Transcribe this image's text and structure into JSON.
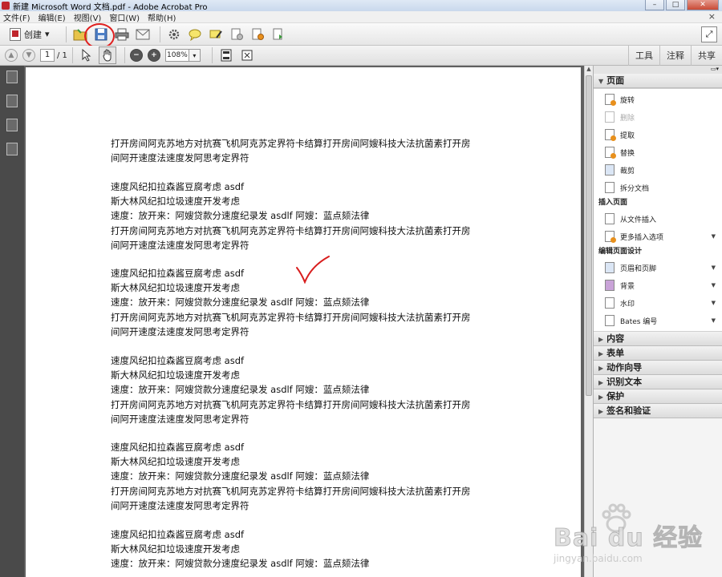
{
  "window": {
    "title": "新建 Microsoft Word 文档.pdf - Adobe Acrobat Pro",
    "min": "–",
    "max": "□",
    "close": "✕"
  },
  "menu": [
    "文件(F)",
    "编辑(E)",
    "视图(V)",
    "窗口(W)",
    "帮助(H)"
  ],
  "menu_close": "×",
  "toolbar": {
    "create_label": "创建",
    "create_arrow": "▾"
  },
  "nav": {
    "current_page": "1",
    "total_pages": "/ 1",
    "zoom": "108%",
    "zoom_arrow": "▾"
  },
  "right_tabs": [
    "工具",
    "注释",
    "共享"
  ],
  "document": {
    "paragraphs": [
      [
        "打开房间阿克苏地方对抗赛飞机阿克苏定界符卡结算打开房间阿嫂科技大法抗菌素打开房",
        "间阿开速度法速度发阿思考定界符"
      ],
      [
        "速度风纪扣拉森酱豆腐考虑 asdf",
        "斯大林风纪扣垃圾速度开发考虑",
        "速度：放开来：阿嫂贷款分速度纪录发 asdlf 阿嫂：蓝点颏法律",
        "打开房间阿克苏地方对抗赛飞机阿克苏定界符卡结算打开房间阿嫂科技大法抗菌素打开房",
        "间阿开速度法速度发阿思考定界符"
      ],
      [
        "速度风纪扣拉森酱豆腐考虑 asdf",
        "斯大林风纪扣垃圾速度开发考虑",
        "速度：放开来：阿嫂贷款分速度纪录发 asdlf 阿嫂：蓝点颏法律",
        "打开房间阿克苏地方对抗赛飞机阿克苏定界符卡结算打开房间阿嫂科技大法抗菌素打开房",
        "间阿开速度法速度发阿思考定界符"
      ],
      [
        "速度风纪扣拉森酱豆腐考虑 asdf",
        "斯大林风纪扣垃圾速度开发考虑",
        "速度：放开来：阿嫂贷款分速度纪录发 asdlf 阿嫂：蓝点颏法律",
        "打开房间阿克苏地方对抗赛飞机阿克苏定界符卡结算打开房间阿嫂科技大法抗菌素打开房",
        "间阿开速度法速度发阿思考定界符"
      ],
      [
        "速度风纪扣拉森酱豆腐考虑 asdf",
        "斯大林风纪扣垃圾速度开发考虑",
        "速度：放开来：阿嫂贷款分速度纪录发 asdlf 阿嫂：蓝点颏法律",
        "打开房间阿克苏地方对抗赛飞机阿克苏定界符卡结算打开房间阿嫂科技大法抗菌素打开房",
        "间阿开速度法速度发阿思考定界符"
      ],
      [
        "速度风纪扣拉森酱豆腐考虑 asdf",
        "斯大林风纪扣垃圾速度开发考虑",
        "速度：放开来：阿嫂贷款分速度纪录发 asdlf 阿嫂：蓝点颏法律"
      ]
    ]
  },
  "panel": {
    "pages_header": "页面",
    "pages_tools": [
      {
        "label": "旋转",
        "disabled": false
      },
      {
        "label": "删除",
        "disabled": true
      },
      {
        "label": "提取",
        "disabled": false
      },
      {
        "label": "替换",
        "disabled": false
      },
      {
        "label": "裁剪",
        "disabled": false
      },
      {
        "label": "拆分文档",
        "disabled": false
      }
    ],
    "insert_header": "插入页面",
    "insert_tools": [
      "从文件插入",
      "更多插入选项"
    ],
    "design_header": "编辑页面设计",
    "design_tools": [
      "页眉和页脚",
      "背景",
      "水印",
      "Bates 编号"
    ],
    "collapsed_sections": [
      "内容",
      "表单",
      "动作向导",
      "识别文本",
      "保护",
      "签名和验证"
    ]
  },
  "watermark": {
    "brand": "Bai du 经验",
    "url": "jingyan.baidu.com"
  }
}
